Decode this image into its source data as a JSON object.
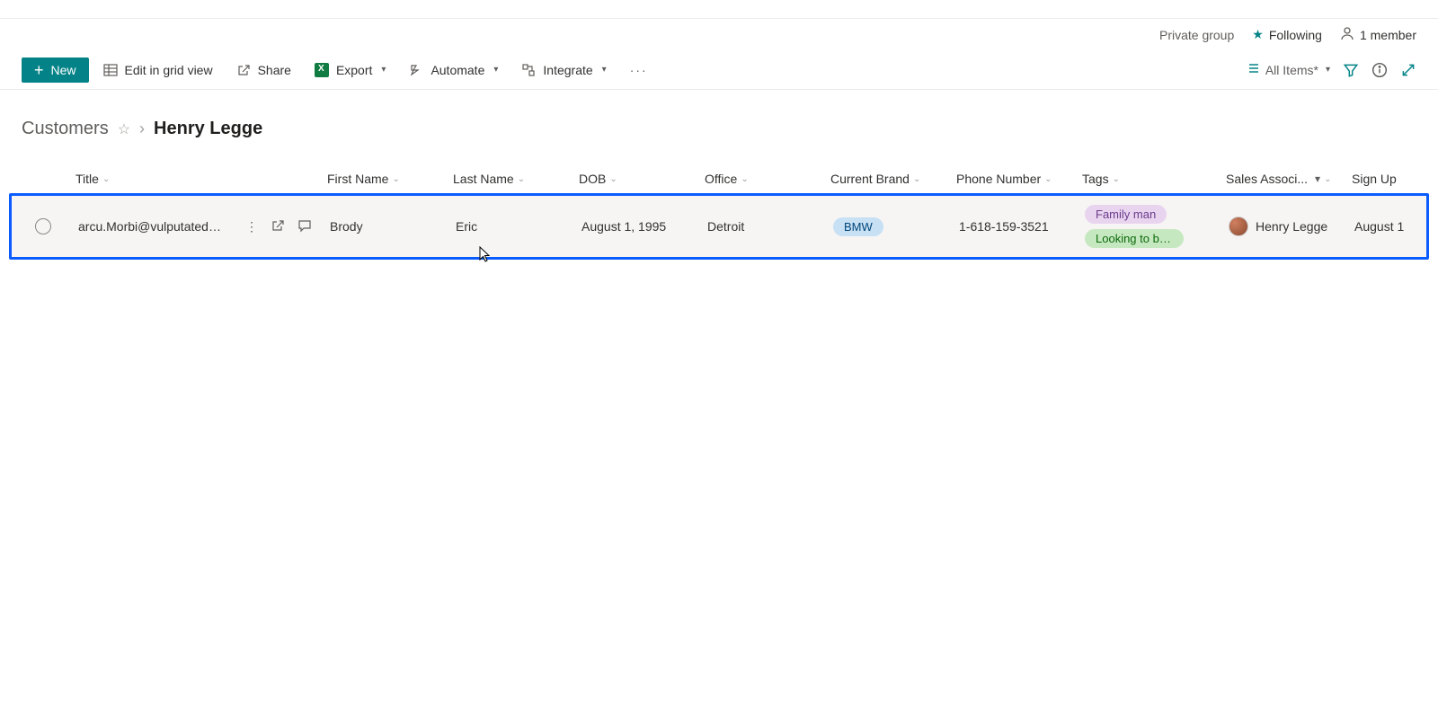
{
  "header": {
    "group_type": "Private group",
    "following_label": "Following",
    "members_label": "1 member"
  },
  "toolbar": {
    "new_label": "New",
    "edit_label": "Edit in grid view",
    "share_label": "Share",
    "export_label": "Export",
    "automate_label": "Automate",
    "integrate_label": "Integrate",
    "view_name": "All Items*"
  },
  "breadcrumb": {
    "root": "Customers",
    "current": "Henry Legge"
  },
  "columns": {
    "title": "Title",
    "first_name": "First Name",
    "last_name": "Last Name",
    "dob": "DOB",
    "office": "Office",
    "current_brand": "Current Brand",
    "phone": "Phone Number",
    "tags": "Tags",
    "sales_associate": "Sales Associ...",
    "sign_up": "Sign Up"
  },
  "rows": [
    {
      "title": "arcu.Morbi@vulputatedui...",
      "first_name": "Brody",
      "last_name": "Eric",
      "dob": "August 1, 1995",
      "office": "Detroit",
      "current_brand": "BMW",
      "phone": "1-618-159-3521",
      "tags": [
        "Family man",
        "Looking to buy s..."
      ],
      "sales_associate": "Henry Legge",
      "sign_up": "August 1"
    }
  ]
}
